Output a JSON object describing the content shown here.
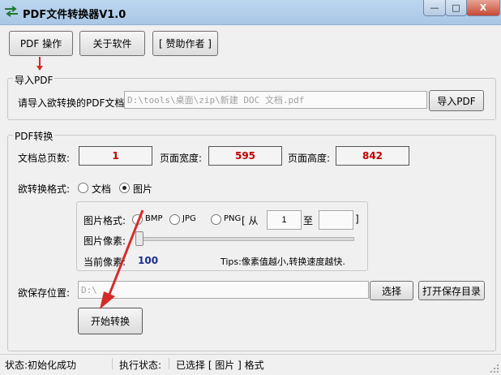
{
  "window": {
    "title": "PDF文件转换器V1.0",
    "minimize": "—",
    "maximize": "□",
    "close": "X"
  },
  "toolbar": {
    "pdf_ops": "PDF 操作",
    "about": "关于软件",
    "sponsor": "[ 赞助作者 ]"
  },
  "import_group": {
    "label": "导入PDF",
    "prompt": "请导入欲转换的PDF文档:",
    "path_value": "D:\\tools\\桌面\\zip\\新建 DOC 文档.pdf",
    "import_button": "导入PDF"
  },
  "convert_group": {
    "label": "PDF转换",
    "total_pages_label": "文档总页数:",
    "total_pages": "1",
    "width_label": "页面宽度:",
    "width": "595",
    "height_label": "页面高度:",
    "height": "842",
    "format_label": "欲转换格式:",
    "format_options": [
      "文档",
      "图片"
    ],
    "format_selected": "图片",
    "image": {
      "format_label": "图片格式:",
      "formats": [
        "BMP",
        "JPG",
        "PNG"
      ],
      "range_open": "[ 从",
      "from_value": "1",
      "to_label": "至",
      "to_value": "",
      "range_close": "]",
      "pixel_label": "图片像素:",
      "slider_level": 0,
      "current_label": "当前像素:",
      "current_value": "100",
      "tips": "Tips:像素值越小,转换速度越快."
    },
    "save_label": "欲保存位置:",
    "save_value": "D:\\",
    "choose_button": "选择",
    "open_dir_button": "打开保存目录",
    "start_button": "开始转换"
  },
  "status": {
    "left": "状态:初始化成功",
    "mid_label": "执行状态:",
    "mid_value": "已选择 [ 图片 ] 格式"
  },
  "colors": {
    "accent": "#d42a2a",
    "readout": "#c00000",
    "current_value": "#1c2f8c"
  }
}
